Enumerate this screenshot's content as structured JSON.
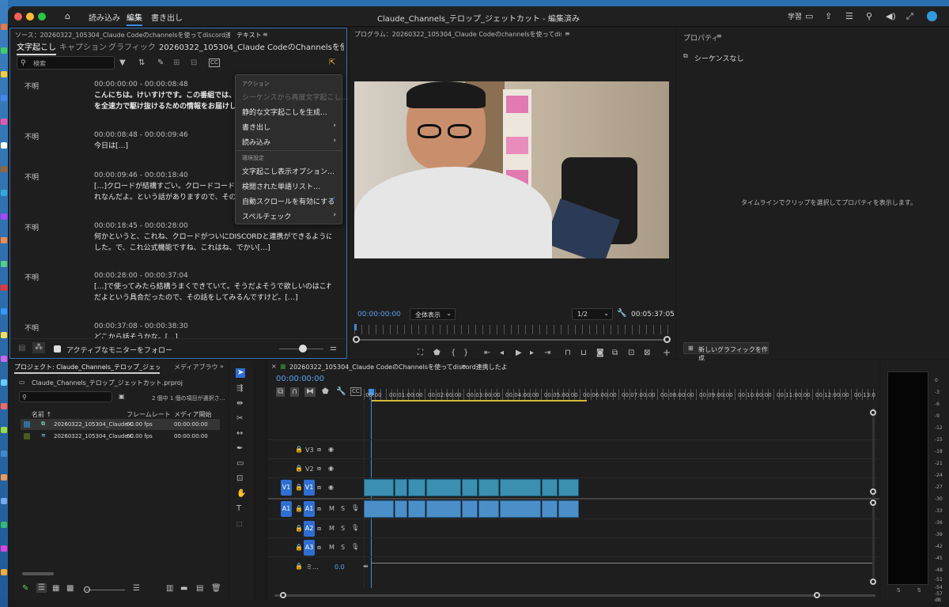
{
  "menubar": {
    "items": [
      "読み込み",
      "編集",
      "書き出し"
    ],
    "active": "編集",
    "title": "Claude_Channels_テロップ_ジェットカット - 編集済み",
    "right_label": "学習"
  },
  "source_panel": {
    "header": "ソース：20260322_105304_Claude Codeのchannelsを使ってdiscord連携したよ.mp4",
    "text_tab": "テキスト",
    "tabs": [
      "文字起こし",
      "キャプション",
      "グラフィック"
    ],
    "clip_name": "20260322_105304_Claude CodeのChannelsを使ってdiscord連携…",
    "search_placeholder": "検索",
    "follow_label": "アクティブなモニターをフォロー",
    "entries": [
      {
        "speaker": "不明",
        "timecode": "00:00:00:00 - 00:00:08:48",
        "lines": [
          "こんにちは。けいすけです。この番組では、AIと",
          "を全速力で駆け抜けるための情報をお届けしてい"
        ],
        "bold": true
      },
      {
        "speaker": "不明",
        "timecode": "00:00:08:48 - 00:00:09:46",
        "lines": [
          "今日は[…]"
        ],
        "bold": false
      },
      {
        "speaker": "不明",
        "timecode": "00:00:09:46 - 00:00:18:40",
        "lines": [
          "[…]クロードが結構すごい。クロードコードが結構",
          "れなんだよ。という話がありますので、その話を"
        ],
        "bold": false
      },
      {
        "speaker": "不明",
        "timecode": "00:00:18:45 - 00:00:28:00",
        "lines": [
          "何かというと、これね、クロードがついにDISCORDと連携ができるようになりま",
          "した。で、これ公式機能ですね、これはね、でかい[…]"
        ],
        "bold": false
      },
      {
        "speaker": "不明",
        "timecode": "00:00:28:00 - 00:00:37:04",
        "lines": [
          "[…]で使ってみたら結構うまくできていて。そうだよそうで欲しいのはこれだたん",
          "だよという具合だったので、その話をしてみるんですけど。[…]"
        ],
        "bold": false
      },
      {
        "speaker": "不明",
        "timecode": "00:00:37:08 - 00:00:38:30",
        "lines": [
          "どこから話そうかな。[…]"
        ],
        "bold": false
      }
    ]
  },
  "context_menu": {
    "section1": "アクション",
    "items1": [
      {
        "label": "シーケンスから再度文字起こし…",
        "disabled": true
      },
      {
        "label": "静的な文字起こしを生成…"
      },
      {
        "label": "書き出し",
        "submenu": true
      },
      {
        "label": "読み込み",
        "submenu": true
      }
    ],
    "section2": "環境設定",
    "items2": [
      {
        "label": "文字起こし表示オプション…"
      },
      {
        "label": "検閲された単語リスト…"
      },
      {
        "label": "自動スクロールを有効にする",
        "checked": true
      },
      {
        "label": "スペルチェック",
        "submenu": true
      }
    ]
  },
  "program_monitor": {
    "header": "プログラム：20260322_105304_Claude Codeのchannelsを使ってdiscord連携したよ",
    "timecode": "00:00:00:00",
    "zoom": "全体表示",
    "resolution": "1/2",
    "duration": "00:05:37:05"
  },
  "properties": {
    "header": "プロパティ",
    "no_sequence": "シーケンスなし",
    "hint": "タイムラインでクリップを選択してプロパティを表示します。",
    "new_graphic": "新しいグラフィックを作成"
  },
  "project_panel": {
    "tab": "プロジェクト: Claude_Channels_テロップ_ジェットカット",
    "tab2": "メディアブラウ",
    "file": "Claude_Channels_テロップ_ジェットカット.prproj",
    "selection": "2 個中 1 個の項目が選択さ…",
    "columns": [
      "名前",
      "フレームレート",
      "メディア開始"
    ],
    "rows": [
      {
        "name": "20260322_105304_Claude C",
        "fps": "60.00 fps",
        "start": "00:00:00:00"
      },
      {
        "name": "20260322_105304_Claude C",
        "fps": "60.00 fps",
        "start": "00:00:00:00"
      }
    ]
  },
  "timeline": {
    "tab": "20260322_105304_Claude CodeのChannelsを使ってdiscord連携したよ",
    "timecode": "00:00:00:00",
    "ruler": [
      ":00:00",
      "00:01:00:00",
      "00:02:00:00",
      "00:03:00:00",
      "00:04:00:00",
      "00:05:00:00",
      "00:06:00:00",
      "00:07:00:00",
      "00:08:00:00",
      "00:09:00:00",
      "00:10:00:00",
      "00:11:00:00",
      "00:12:00:00",
      "00:13:0"
    ],
    "video_tracks": [
      "V3",
      "V2",
      "V1"
    ],
    "audio_tracks": [
      "A1",
      "A2",
      "A3"
    ],
    "src_v": "V1",
    "src_a": "A1",
    "mix_label": "ミ…",
    "mix_value": "0.0",
    "mute": "M",
    "solo": "S"
  },
  "meter": {
    "labels": [
      "0",
      "-3",
      "-6",
      "-9",
      "-12",
      "-15",
      "-18",
      "-21",
      "-24",
      "-27",
      "-30",
      "-33",
      "-36",
      "-39",
      "-42",
      "-45",
      "-48",
      "-51",
      "-54",
      "-57",
      "dB"
    ],
    "bottom": [
      "S",
      "S"
    ]
  },
  "colors": {
    "accent": "#2d6fd4",
    "playhead": "#3a8ee6"
  }
}
